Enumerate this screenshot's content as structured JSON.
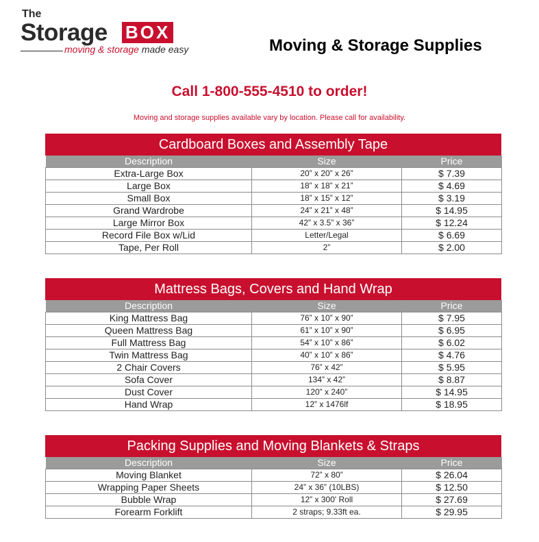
{
  "logo": {
    "the": "The",
    "storage": "Storage",
    "box": "BOX",
    "tagline_main": "moving & storage",
    "tagline_tail": "made easy"
  },
  "page_title": "Moving & Storage Supplies",
  "call_line": "Call 1-800-555-4510 to order!",
  "availability_note": "Moving and storage supplies available vary by location. Please call for availability.",
  "columns": {
    "description": "Description",
    "size": "Size",
    "price": "Price"
  },
  "sections": [
    {
      "title": "Cardboard Boxes and Assembly Tape",
      "rows": [
        {
          "description": "Extra-Large Box",
          "size": "20”  x  20”  x  26”",
          "price": "$ 7.39"
        },
        {
          "description": "Large Box",
          "size": "18”  x  18”  x  21”",
          "price": "$ 4.69"
        },
        {
          "description": "Small Box",
          "size": "18”  x  15”  x  12”",
          "price": "$ 3.19"
        },
        {
          "description": "Grand Wardrobe",
          "size": "24”  x  21”  x  48”",
          "price": "$ 14.95"
        },
        {
          "description": "Large Mirror Box",
          "size": "42”  x  3.5”  x  36”",
          "price": "$ 12.24"
        },
        {
          "description": "Record File Box w/Lid",
          "size": "Letter/Legal",
          "price": "$ 6.69"
        },
        {
          "description": "Tape, Per Roll",
          "size": "2”",
          "price": "$ 2.00"
        }
      ]
    },
    {
      "title": "Mattress Bags, Covers and Hand Wrap",
      "rows": [
        {
          "description": "King Mattress Bag",
          "size": "76”  x  10”  x  90”",
          "price": "$ 7.95"
        },
        {
          "description": "Queen Mattress Bag",
          "size": "61”  x  10”  x  90”",
          "price": "$ 6.95"
        },
        {
          "description": "Full Mattress Bag",
          "size": "54”  x  10”  x  86”",
          "price": "$ 6.02"
        },
        {
          "description": "Twin Mattress Bag",
          "size": "40”  x  10”  x  86”",
          "price": "$ 4.76"
        },
        {
          "description": "2 Chair Covers",
          "size": "76”  x   42”",
          "price": "$ 5.95"
        },
        {
          "description": "Sofa Cover",
          "size": "134”  x   42”",
          "price": "$ 8.87"
        },
        {
          "description": "Dust Cover",
          "size": "120”  x   240”",
          "price": "$ 14.95"
        },
        {
          "description": "Hand Wrap",
          "size": "12”  x 1476lf",
          "price": "$ 18.95"
        }
      ]
    },
    {
      "title": "Packing Supplies and Moving Blankets & Straps",
      "rows": [
        {
          "description": "Moving Blanket",
          "size": "72”  x  80”",
          "price": "$ 26.04"
        },
        {
          "description": "Wrapping Paper Sheets",
          "size": "24” x 36” (10LBS)",
          "price": "$ 12.50"
        },
        {
          "description": "Bubble Wrap",
          "size": "12” x 300' Roll",
          "price": "$ 27.69"
        },
        {
          "description": "Forearm Forklift",
          "size": "2 straps; 9.33ft ea.",
          "price": "$ 29.95"
        }
      ]
    }
  ]
}
